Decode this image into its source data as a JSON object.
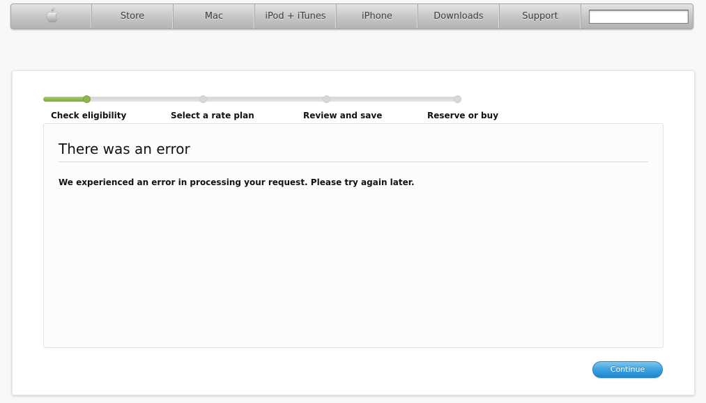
{
  "globalnav": {
    "logo_icon": "apple-logo-icon",
    "items": [
      {
        "label": "Store"
      },
      {
        "label": "Mac"
      },
      {
        "label": "iPod + iTunes"
      },
      {
        "label": "iPhone"
      },
      {
        "label": "Downloads"
      },
      {
        "label": "Support"
      }
    ],
    "search": {
      "value": "",
      "placeholder": ""
    }
  },
  "progress": {
    "fraction_complete": 0.105,
    "steps": [
      {
        "label": "Check eligibility",
        "state": "current"
      },
      {
        "label": "Select a rate plan",
        "state": "pending"
      },
      {
        "label": "Review and save",
        "state": "pending"
      },
      {
        "label": "Reserve or buy",
        "state": "pending"
      }
    ],
    "colors": {
      "complete": "#8cb94a",
      "pending": "#d8d8d8"
    }
  },
  "error": {
    "title": "There was an error",
    "message": "We experienced an error in processing your request. Please try again later."
  },
  "actions": {
    "continue_label": "Continue",
    "continue_color": "#3ca2e0"
  }
}
